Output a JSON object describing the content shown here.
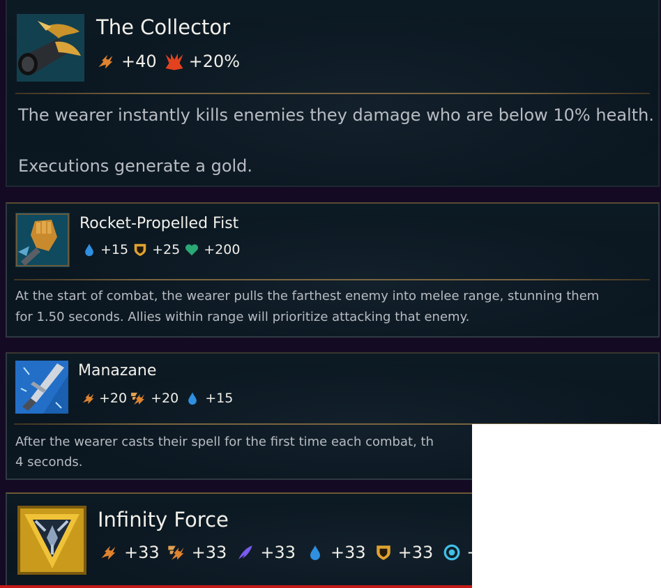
{
  "items": [
    {
      "name": "The Collector",
      "stats": [
        {
          "icon": "attack-damage-icon",
          "value": "+40"
        },
        {
          "icon": "crit-chance-icon",
          "value": "+20%"
        }
      ],
      "description": [
        "The wearer instantly kills enemies they damage who are below 10% health.",
        "Executions generate a gold."
      ]
    },
    {
      "name": "Rocket-Propelled Fist",
      "stats": [
        {
          "icon": "mana-icon",
          "value": "+15"
        },
        {
          "icon": "armor-icon",
          "value": "+25"
        },
        {
          "icon": "health-icon",
          "value": "+200"
        }
      ],
      "description": [
        "At the start of combat, the wearer pulls the farthest enemy into melee range, stunning them",
        "for 1.50 seconds. Allies within range will prioritize attacking that enemy."
      ]
    },
    {
      "name": "Manazane",
      "stats": [
        {
          "icon": "attack-damage-icon",
          "value": "+20"
        },
        {
          "icon": "attack-speed-icon",
          "value": "+20"
        },
        {
          "icon": "mana-icon",
          "value": "+15"
        }
      ],
      "description": [
        "After the wearer casts their spell for the first time each combat, th",
        "4 seconds."
      ]
    },
    {
      "name": "Infinity Force",
      "stats": [
        {
          "icon": "attack-damage-icon",
          "value": "+33"
        },
        {
          "icon": "attack-speed-icon",
          "value": "+33"
        },
        {
          "icon": "ability-power-icon",
          "value": "+33"
        },
        {
          "icon": "mana-icon",
          "value": "+33"
        },
        {
          "icon": "armor-icon",
          "value": "+33"
        },
        {
          "icon": "magic-resist-icon",
          "value": "+:"
        }
      ]
    }
  ],
  "colors": {
    "attack_damage": "#e0832e",
    "crit": "#e2421e",
    "mana": "#2f8fe0",
    "armor": "#e0a230",
    "health": "#2aa875",
    "ability_power": "#7a5cf0",
    "magic_resist": "#3fc0e8",
    "divider": "#7a6540"
  }
}
